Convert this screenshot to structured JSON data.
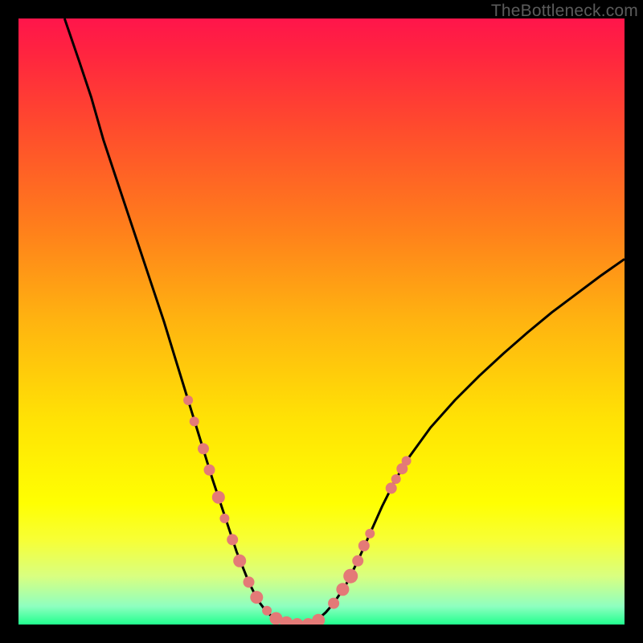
{
  "watermark": "TheBottleneck.com",
  "chart_data": {
    "type": "line",
    "title": "",
    "xlabel": "",
    "ylabel": "",
    "xlim": [
      0,
      100
    ],
    "ylim": [
      0,
      100
    ],
    "grid": false,
    "note": "Gradient background encodes percentage from red (high bottleneck) at top to green (0%) at bottom. V-shaped curve showing bottleneck percentage vs a hidden x-axis variable. Values are approximate, estimated from pixel positions (no axis ticks visible).",
    "series": [
      {
        "name": "bottleneck-curve",
        "x": [
          7.6,
          10,
          12,
          14,
          16,
          18,
          20,
          22,
          24,
          26,
          28,
          30,
          32,
          34,
          36,
          38,
          39.5,
          41,
          43,
          45,
          47,
          49,
          50.7,
          52,
          54,
          56,
          58,
          60,
          62,
          64,
          68,
          72,
          76,
          80,
          84,
          88,
          92,
          96,
          100
        ],
        "y": [
          100,
          93,
          87,
          80,
          74,
          68,
          62,
          56,
          50,
          43.5,
          37,
          30.5,
          24,
          18,
          12,
          7,
          4,
          2,
          0.5,
          0,
          0,
          0.5,
          2,
          3.5,
          6.5,
          10.5,
          15,
          19.5,
          23.5,
          27,
          32.5,
          37,
          41,
          44.7,
          48.2,
          51.5,
          54.5,
          57.5,
          60.3
        ]
      }
    ],
    "markers": [
      {
        "x": 28.0,
        "y": 37.0,
        "r": 6
      },
      {
        "x": 29.0,
        "y": 33.5,
        "r": 6
      },
      {
        "x": 30.5,
        "y": 29.0,
        "r": 7
      },
      {
        "x": 31.5,
        "y": 25.5,
        "r": 7
      },
      {
        "x": 33.0,
        "y": 21.0,
        "r": 8
      },
      {
        "x": 34.0,
        "y": 17.5,
        "r": 6
      },
      {
        "x": 35.3,
        "y": 14.0,
        "r": 7
      },
      {
        "x": 36.5,
        "y": 10.5,
        "r": 8
      },
      {
        "x": 38.0,
        "y": 7.0,
        "r": 7
      },
      {
        "x": 39.3,
        "y": 4.5,
        "r": 8
      },
      {
        "x": 41.0,
        "y": 2.3,
        "r": 6
      },
      {
        "x": 42.5,
        "y": 1.0,
        "r": 8
      },
      {
        "x": 44.2,
        "y": 0.3,
        "r": 8
      },
      {
        "x": 46.0,
        "y": 0.0,
        "r": 8
      },
      {
        "x": 47.8,
        "y": 0.0,
        "r": 8
      },
      {
        "x": 49.5,
        "y": 0.7,
        "r": 8
      },
      {
        "x": 52.0,
        "y": 3.5,
        "r": 7
      },
      {
        "x": 53.5,
        "y": 5.8,
        "r": 8
      },
      {
        "x": 54.8,
        "y": 8.0,
        "r": 9
      },
      {
        "x": 56.0,
        "y": 10.5,
        "r": 7
      },
      {
        "x": 57.0,
        "y": 13.0,
        "r": 7
      },
      {
        "x": 58.0,
        "y": 15.0,
        "r": 6
      },
      {
        "x": 61.5,
        "y": 22.5,
        "r": 7
      },
      {
        "x": 62.3,
        "y": 24.0,
        "r": 6
      },
      {
        "x": 63.3,
        "y": 25.7,
        "r": 7
      },
      {
        "x": 64.0,
        "y": 27.0,
        "r": 6
      }
    ]
  }
}
